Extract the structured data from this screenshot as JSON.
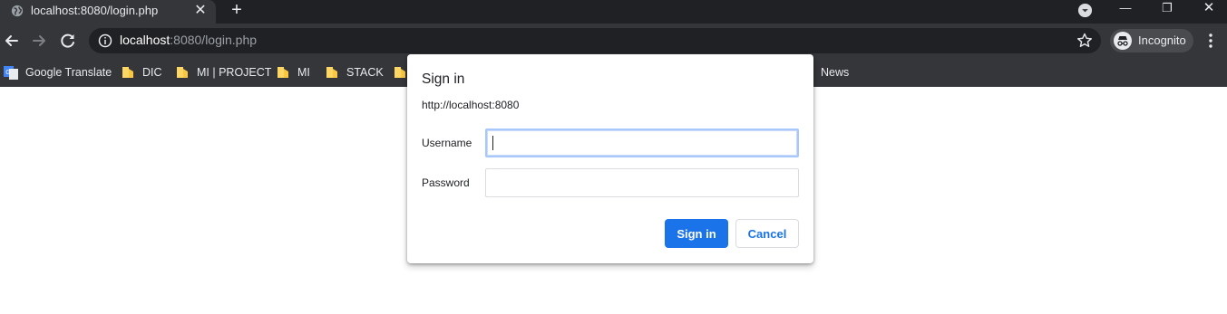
{
  "tab": {
    "title": "localhost:8080/login.php",
    "close_glyph": "✕",
    "new_tab_glyph": "+",
    "favicon": "globe-icon"
  },
  "window_controls": {
    "minimize": "—",
    "restore": "❐",
    "close": "✕"
  },
  "omnibox": {
    "host": "localhost",
    "rest": ":8080/login.php"
  },
  "profile": {
    "label": "Incognito"
  },
  "bookmarks": [
    {
      "label": "Google Translate",
      "icon": "google-translate-icon"
    },
    {
      "label": "DIC",
      "icon": "folder-icon"
    },
    {
      "label": "MI | PROJECT",
      "icon": "folder-icon"
    },
    {
      "label": "MI",
      "icon": "folder-icon"
    },
    {
      "label": "STACK",
      "icon": "folder-icon"
    },
    {
      "label": "",
      "icon": "folder-icon"
    },
    {
      "label": "News",
      "icon": "folder-icon"
    }
  ],
  "dialog": {
    "title": "Sign in",
    "origin": "http://localhost:8080",
    "username_label": "Username",
    "username_value": "",
    "password_label": "Password",
    "password_value": "",
    "sign_in_label": "Sign in",
    "cancel_label": "Cancel"
  },
  "colors": {
    "chrome_dark": "#202124",
    "toolbar": "#35363a",
    "accent": "#1a73e8",
    "folder": "#fdd663"
  }
}
